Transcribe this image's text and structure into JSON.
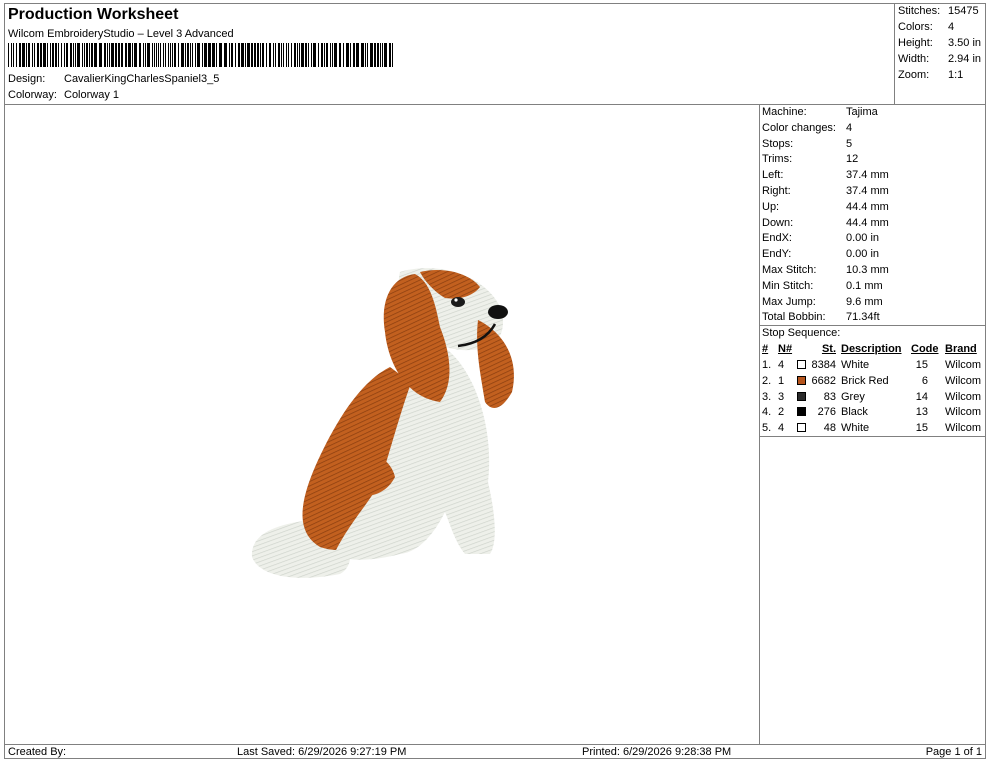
{
  "header": {
    "title": "Production Worksheet",
    "software": "Wilcom EmbroideryStudio – Level 3 Advanced",
    "design_label": "Design:",
    "design_value": "CavalierKingCharlesSpaniel3_5",
    "colorway_label": "Colorway:",
    "colorway_value": "Colorway 1"
  },
  "stats": [
    {
      "label": "Stitches:",
      "value": "15475"
    },
    {
      "label": "Colors:",
      "value": "4"
    },
    {
      "label": "Height:",
      "value": "3.50 in"
    },
    {
      "label": "Width:",
      "value": "2.94 in"
    },
    {
      "label": "Zoom:",
      "value": "1:1"
    }
  ],
  "details": [
    {
      "label": "Machine:",
      "value": "Tajima"
    },
    {
      "label": "Color changes:",
      "value": "4"
    },
    {
      "label": "Stops:",
      "value": "5"
    },
    {
      "label": "Trims:",
      "value": "12"
    },
    {
      "label": "Left:",
      "value": "37.4 mm"
    },
    {
      "label": "Right:",
      "value": "37.4 mm"
    },
    {
      "label": "Up:",
      "value": "44.4 mm"
    },
    {
      "label": "Down:",
      "value": "44.4 mm"
    },
    {
      "label": "EndX:",
      "value": "0.00 in"
    },
    {
      "label": "EndY:",
      "value": "0.00 in"
    },
    {
      "label": "Max Stitch:",
      "value": "10.3 mm"
    },
    {
      "label": "Min Stitch:",
      "value": "0.1 mm"
    },
    {
      "label": "Max Jump:",
      "value": "9.6 mm"
    },
    {
      "label": "Total Bobbin:",
      "value": "71.34ft"
    }
  ],
  "stop_sequence": {
    "title": "Stop Sequence:",
    "headers": {
      "num": "#",
      "n": "N#",
      "st": "St.",
      "desc": "Description",
      "code": "Code",
      "brand": "Brand"
    },
    "rows": [
      {
        "num": "1.",
        "n": "4",
        "st": "8384",
        "desc": "White",
        "code": "15",
        "brand": "Wilcom",
        "color": "#ffffff"
      },
      {
        "num": "2.",
        "n": "1",
        "st": "6682",
        "desc": "Brick Red",
        "code": "6",
        "brand": "Wilcom",
        "color": "#b5541c"
      },
      {
        "num": "3.",
        "n": "3",
        "st": "83",
        "desc": "Grey",
        "code": "14",
        "brand": "Wilcom",
        "color": "#2a2a2a"
      },
      {
        "num": "4.",
        "n": "2",
        "st": "276",
        "desc": "Black",
        "code": "13",
        "brand": "Wilcom",
        "color": "#000000"
      },
      {
        "num": "5.",
        "n": "4",
        "st": "48",
        "desc": "White",
        "code": "15",
        "brand": "Wilcom",
        "color": "#ffffff"
      }
    ]
  },
  "footer": {
    "created_by": "Created By:",
    "last_saved": "Last Saved: 6/29/2026 9:27:19 PM",
    "printed": "Printed: 6/29/2026 9:28:38 PM",
    "page": "Page 1 of 1"
  },
  "design_preview": {
    "icon": "spaniel-embroidery-image"
  }
}
